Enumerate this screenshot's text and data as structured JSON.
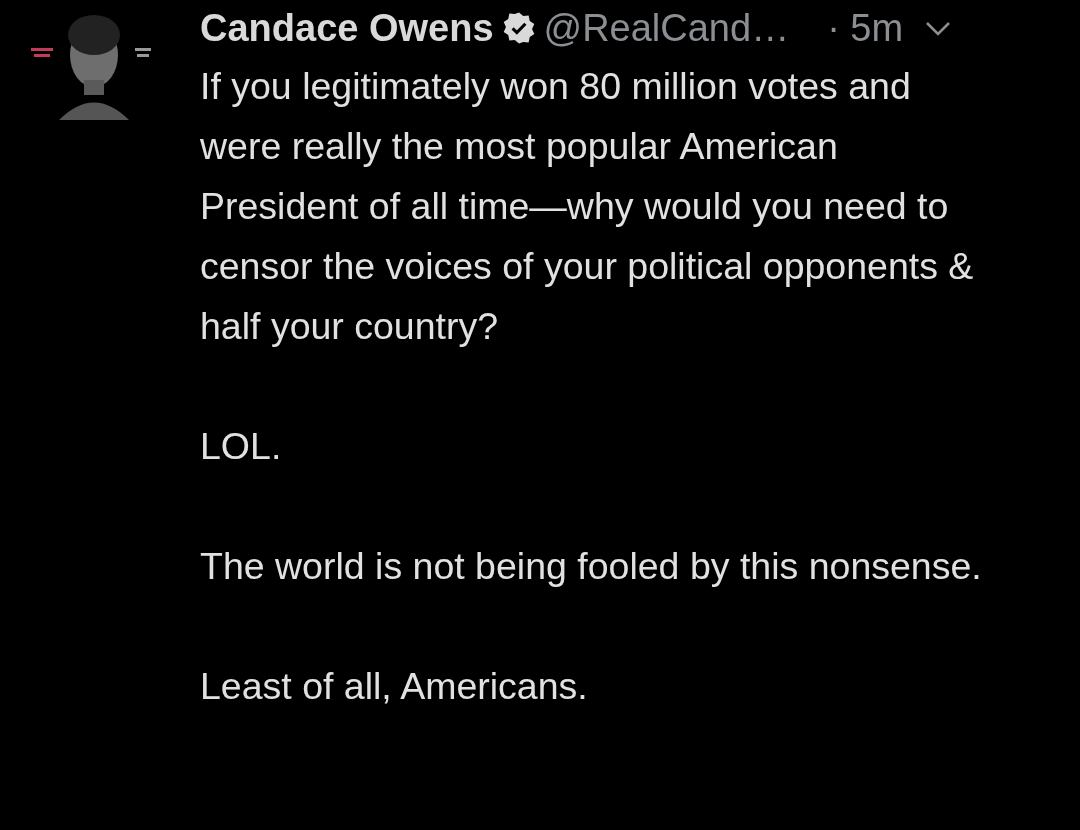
{
  "tweet": {
    "author": {
      "name": "Candace Owens",
      "verified": true,
      "handle": "@RealCand…"
    },
    "time": "· 5m",
    "paragraphs": [
      "If you legitimately won 80 million votes and were really the most popular American President of all time—why would you need to censor the voices of your political opponents & half your country?",
      "LOL.",
      "The world is not being fooled by this nonsense.",
      "Least of all, Americans."
    ]
  }
}
